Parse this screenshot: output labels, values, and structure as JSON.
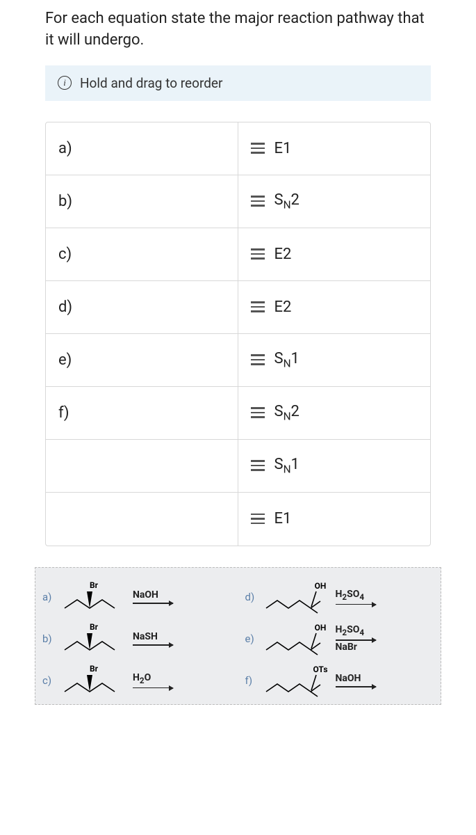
{
  "question": "For each equation state the major reaction pathway that it will undergo.",
  "instruction": "Hold and drag to reorder",
  "rows": [
    {
      "left": "a)",
      "right": "E1"
    },
    {
      "left": "b)",
      "right": "SN2"
    },
    {
      "left": "c)",
      "right": "E2"
    },
    {
      "left": "d)",
      "right": "E2"
    },
    {
      "left": "e)",
      "right": "SN1"
    },
    {
      "left": "f)",
      "right": "SN2"
    },
    {
      "left": "",
      "right": "SN1"
    },
    {
      "left": "",
      "right": "E1"
    }
  ],
  "reactions": [
    {
      "label": "a)",
      "substituent": "Br",
      "type": "secondary",
      "reagents": [
        "NaOH"
      ]
    },
    {
      "label": "d)",
      "substituent": "OH",
      "type": "tertiary",
      "reagents": [
        "H2SO4"
      ]
    },
    {
      "label": "b)",
      "substituent": "Br",
      "type": "secondary",
      "reagents": [
        "NaSH"
      ]
    },
    {
      "label": "e)",
      "substituent": "OH",
      "type": "tertiary",
      "reagents": [
        "H2SO4",
        "NaBr"
      ]
    },
    {
      "label": "c)",
      "substituent": "Br",
      "type": "secondary",
      "reagents": [
        "H2O"
      ]
    },
    {
      "label": "f)",
      "substituent": "OTs",
      "type": "tertiary",
      "reagents": [
        "NaOH"
      ]
    }
  ]
}
